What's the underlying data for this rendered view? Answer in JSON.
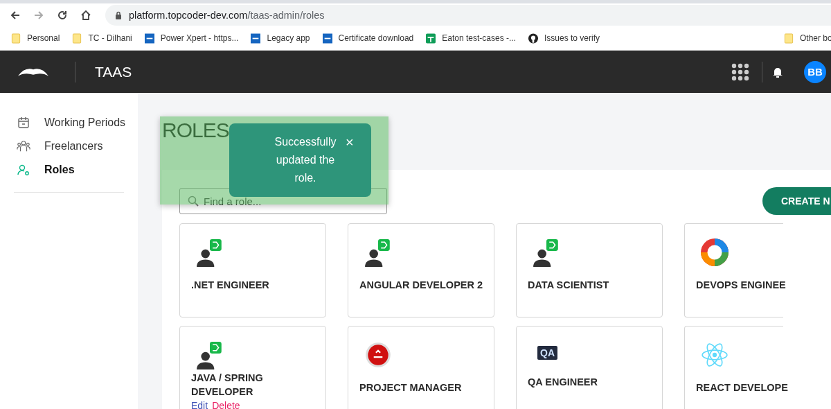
{
  "browser": {
    "url_host": "platform.topcoder-dev.com",
    "url_path": "/taas-admin/roles",
    "bookmarks": [
      {
        "kind": "folder",
        "label": "Personal"
      },
      {
        "kind": "folder",
        "label": "TC - Dilhani"
      },
      {
        "kind": "pxd",
        "label": "Power Xpert - https..."
      },
      {
        "kind": "pxd",
        "label": "Legacy app"
      },
      {
        "kind": "pxd",
        "label": "Certificate download"
      },
      {
        "kind": "sheet",
        "label": "Eaton test-cases -..."
      },
      {
        "kind": "github",
        "label": "Issues to verify"
      }
    ],
    "other_bookmarks": "Other bo"
  },
  "header": {
    "brand": "TAAS",
    "avatar": "BB"
  },
  "sidebar": {
    "items": [
      {
        "label": "Working Periods",
        "selected": false
      },
      {
        "label": "Freelancers",
        "selected": false
      },
      {
        "label": "Roles",
        "selected": true
      }
    ]
  },
  "page": {
    "title": "ROLES",
    "search": {
      "placeholder": "Find a role..."
    },
    "create_button": "CREATE N"
  },
  "toast": {
    "message": "Successfully updated the role.",
    "close": "×"
  },
  "roles": [
    {
      "kind": "person",
      "name": ".NET ENGINEER"
    },
    {
      "kind": "person",
      "name": "ANGULAR DEVELOPER 2"
    },
    {
      "kind": "person",
      "name": "DATA SCIENTIST"
    },
    {
      "kind": "wheel",
      "name": "DEVOPS ENGINEE"
    },
    {
      "kind": "person",
      "name": "JAVA / SPRING DEVELOPER",
      "actions": [
        "Edit",
        "Delete"
      ]
    },
    {
      "kind": "disc",
      "name": "PROJECT MANAGER"
    },
    {
      "kind": "logo",
      "name": "QA ENGINEER",
      "logo": "QA"
    },
    {
      "kind": "atom",
      "name": "REACT DEVELOPE"
    }
  ]
}
